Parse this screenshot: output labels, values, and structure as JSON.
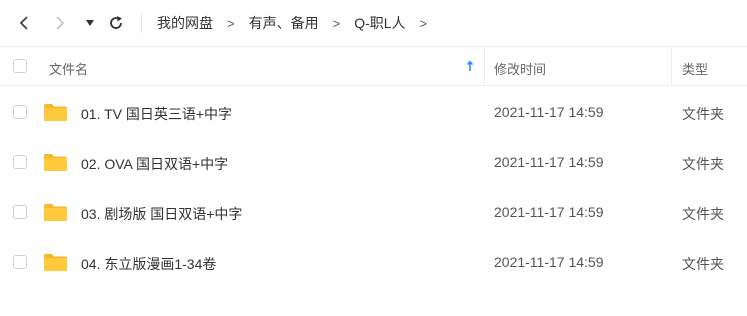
{
  "toolbar": {
    "back_icon": "chevron-left-icon",
    "forward_icon": "chevron-right-icon",
    "dropdown_icon": "caret-down-icon",
    "refresh_icon": "refresh-icon",
    "breadcrumb": [
      "我的网盘",
      "有声、备用",
      "Q-职L人"
    ],
    "breadcrumb_arrow": ">"
  },
  "table": {
    "columns": {
      "name": "文件名",
      "modified": "修改时间",
      "type": "类型"
    },
    "sort_icon": "sort-ascending-icon",
    "rows": [
      {
        "name": "01. TV 国日英三语+中字",
        "modified": "2021-11-17 14:59",
        "type": "文件夹",
        "icon": "folder-icon"
      },
      {
        "name": "02. OVA 国日双语+中字",
        "modified": "2021-11-17 14:59",
        "type": "文件夹",
        "icon": "folder-icon"
      },
      {
        "name": "03. 剧场版 国日双语+中字",
        "modified": "2021-11-17 14:59",
        "type": "文件夹",
        "icon": "folder-icon"
      },
      {
        "name": "04. 东立版漫画1-34卷",
        "modified": "2021-11-17 14:59",
        "type": "文件夹",
        "icon": "folder-icon"
      }
    ]
  },
  "colors": {
    "folder": "#ffc93c",
    "folder_tab": "#f5b82e",
    "sort_arrow": "#2f8cff"
  }
}
